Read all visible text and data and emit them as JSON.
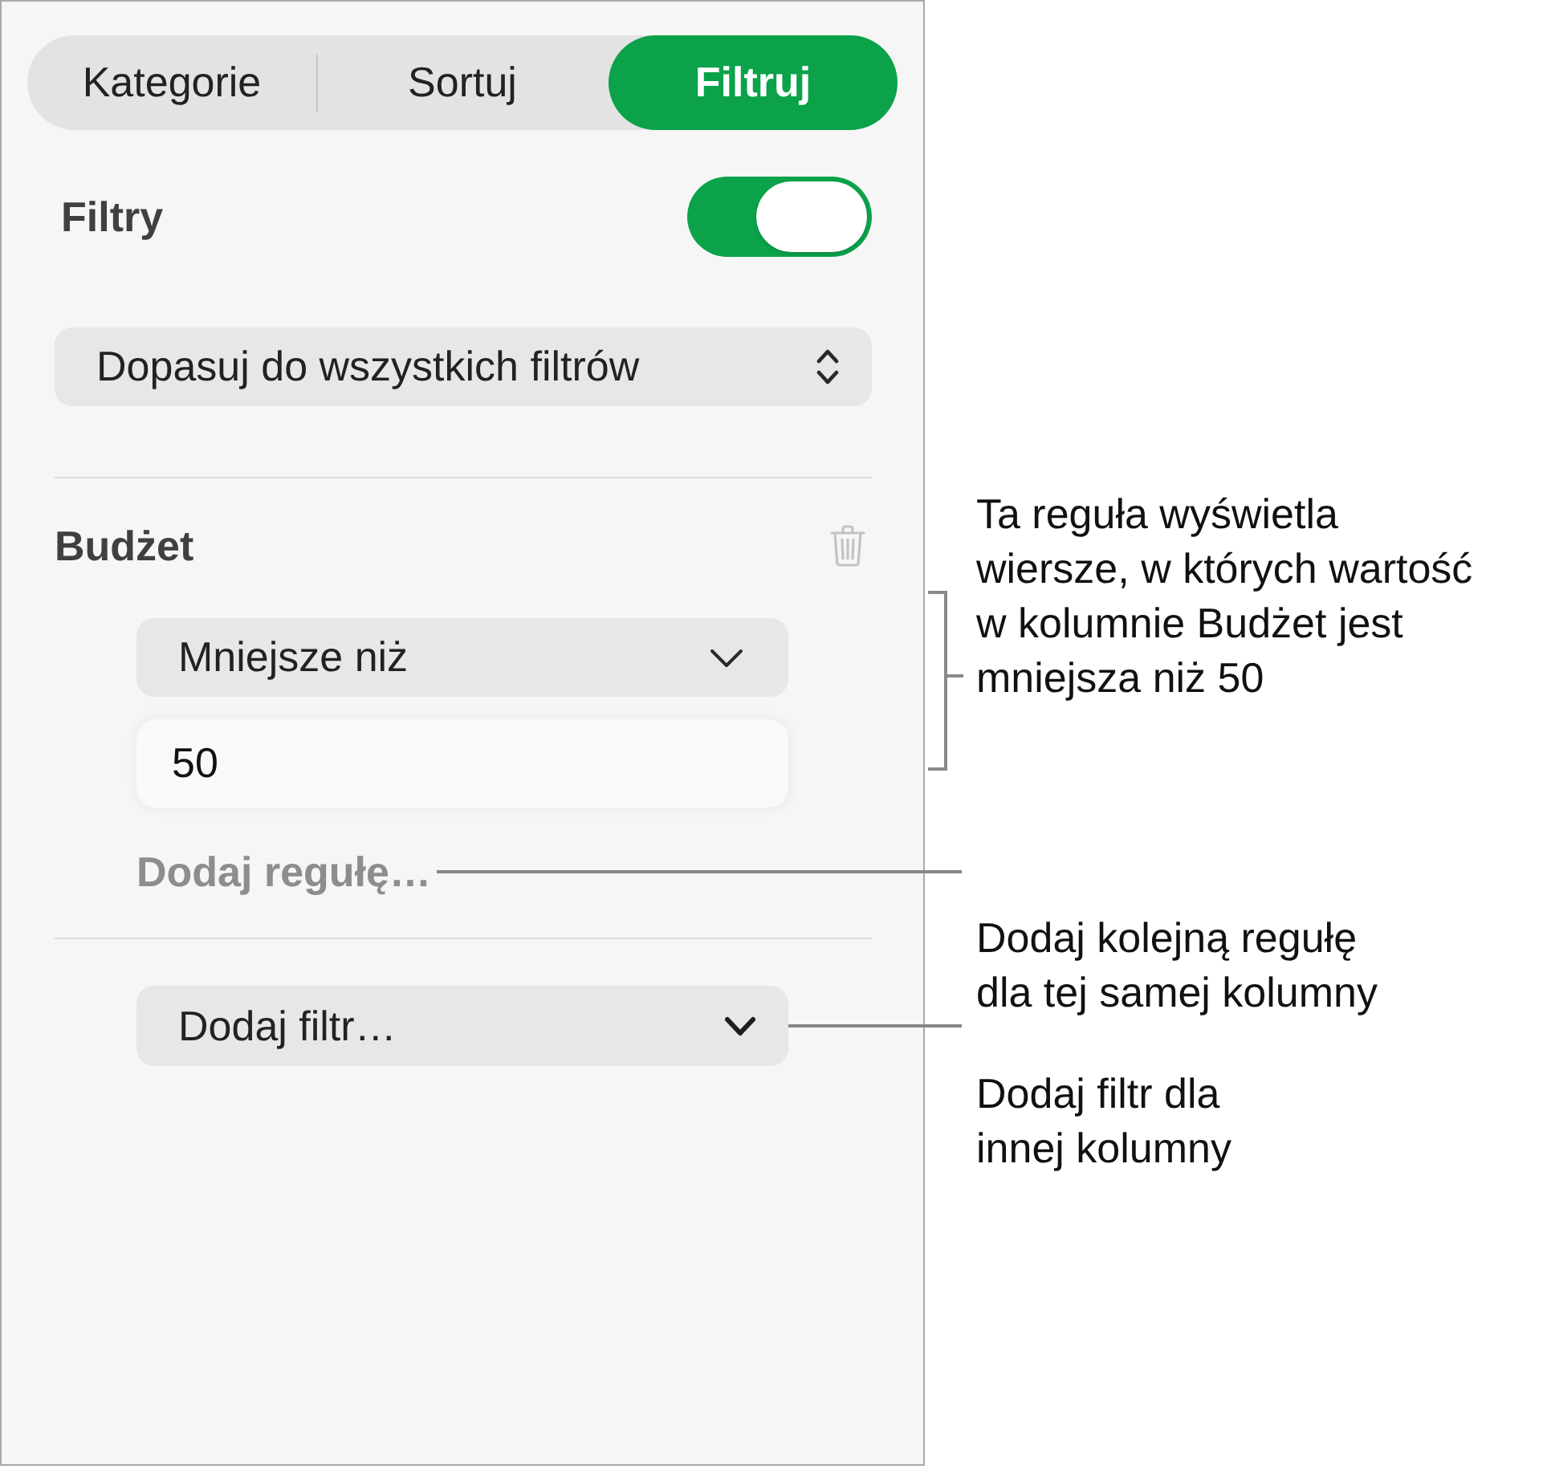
{
  "tabs": [
    {
      "label": "Kategorie",
      "selected": false
    },
    {
      "label": "Sortuj",
      "selected": false
    },
    {
      "label": "Filtruj",
      "selected": true
    }
  ],
  "filters": {
    "label": "Filtry",
    "on": true
  },
  "match_dropdown": {
    "value": "Dopasuj do wszystkich filtrów"
  },
  "rule": {
    "column": "Budżet",
    "condition": "Mniejsze niż",
    "value": "50",
    "add_rule": "Dodaj regułę…"
  },
  "add_filter": {
    "value": "Dodaj filtr…"
  },
  "callouts": [
    {
      "kind": "bracket",
      "text": "Ta reguła wyświetla\nwiersze, w których wartość\nw kolumnie Budżet jest\nmniejsza niż 50"
    },
    {
      "kind": "leader",
      "text": "Dodaj kolejną regułę\ndla tej samej kolumny"
    },
    {
      "kind": "leader",
      "text": "Dodaj filtr dla\ninnej kolumny"
    }
  ]
}
